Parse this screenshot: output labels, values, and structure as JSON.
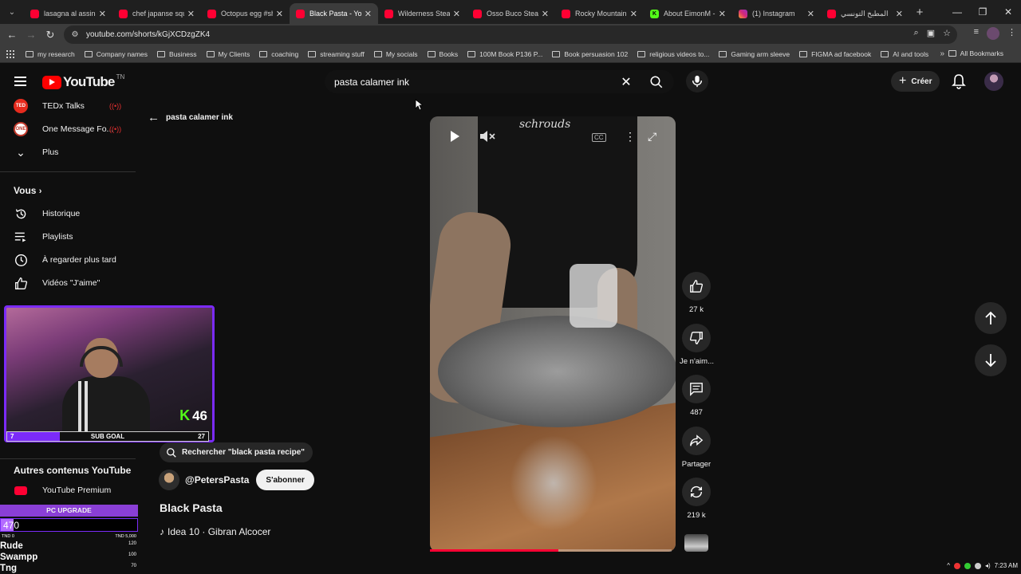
{
  "browser": {
    "tabs": [
      {
        "title": "lasagna al assina",
        "icon": "youtube-icon"
      },
      {
        "title": "chef japanse squ",
        "icon": "youtube-icon"
      },
      {
        "title": "Octopus egg #sh",
        "icon": "youtube-icon"
      },
      {
        "title": "Black Pasta - You",
        "icon": "youtube-icon",
        "active": true
      },
      {
        "title": "Wilderness Steak",
        "icon": "youtube-icon"
      },
      {
        "title": "Osso Buco Steak",
        "icon": "youtube-icon"
      },
      {
        "title": "Rocky Mountain",
        "icon": "youtube-icon"
      },
      {
        "title": "About EimonM -",
        "icon": "kick-icon"
      },
      {
        "title": "(1) Instagram",
        "icon": "instagram-icon"
      },
      {
        "title": "المطبخ التونسي",
        "icon": "youtube-icon"
      }
    ],
    "url": "youtube.com/shorts/kGjXCDzgZK4",
    "bookmarks": [
      "my research",
      "Company names",
      "Business",
      "My Clients",
      "coaching",
      "streaming stuff",
      "My socials",
      "Books",
      "100M Book P136 P...",
      "Book persuasion 102",
      "religious videos to...",
      "Gaming arm sleeve",
      "FIGMA ad facebook",
      "AI and tools"
    ],
    "all_bookmarks": "All Bookmarks"
  },
  "header": {
    "logo": "YouTube",
    "country": "TN",
    "search_query": "pasta calamer ink",
    "create_label": "Créer"
  },
  "sidebar": {
    "subscriptions": [
      {
        "label": "TEDx Talks",
        "badge": "TED",
        "color": "#e62b1e"
      },
      {
        "label": "One Message Fo...",
        "badge": "ONE",
        "color": "#c0392b"
      }
    ],
    "more_label": "Plus",
    "you_heading": "Vous",
    "you_items": [
      "Historique",
      "Playlists",
      "À regarder plus tard",
      "Vidéos \"J'aime\""
    ],
    "other_heading": "Autres contenus YouTube",
    "premium_label": "YouTube Premium"
  },
  "overlay": {
    "kick_count": "46",
    "subgoal": {
      "current": "7",
      "label": "SUB GOAL",
      "target": "27",
      "fraction": 0.26
    },
    "pc_upgrade": {
      "title": "PC UPGRADE",
      "value": "470",
      "min": "TND 0",
      "max": "TND 5,000",
      "fraction": 0.094,
      "leaders": [
        {
          "name": "Rude",
          "value": "120"
        },
        {
          "name": "Swampp",
          "value": "100"
        },
        {
          "name": "Tng",
          "value": "70"
        }
      ]
    }
  },
  "shorts": {
    "back_label": "pasta calamer ink",
    "search_suggestion": "Rechercher \"black pasta recipe\"",
    "channel": "@PetersPasta",
    "subscribe_label": "S'abonner",
    "title": "Black Pasta",
    "music": "Idea 10 · Gibran Alcocer",
    "video_brand_text": "schrouds",
    "progress_fraction": 0.53,
    "actions": {
      "likes": "27 k",
      "dislike_label": "Je n'aim...",
      "comments": "487",
      "share_label": "Partager",
      "remix": "219 k"
    }
  },
  "tray": {
    "time": "7:23 AM"
  }
}
